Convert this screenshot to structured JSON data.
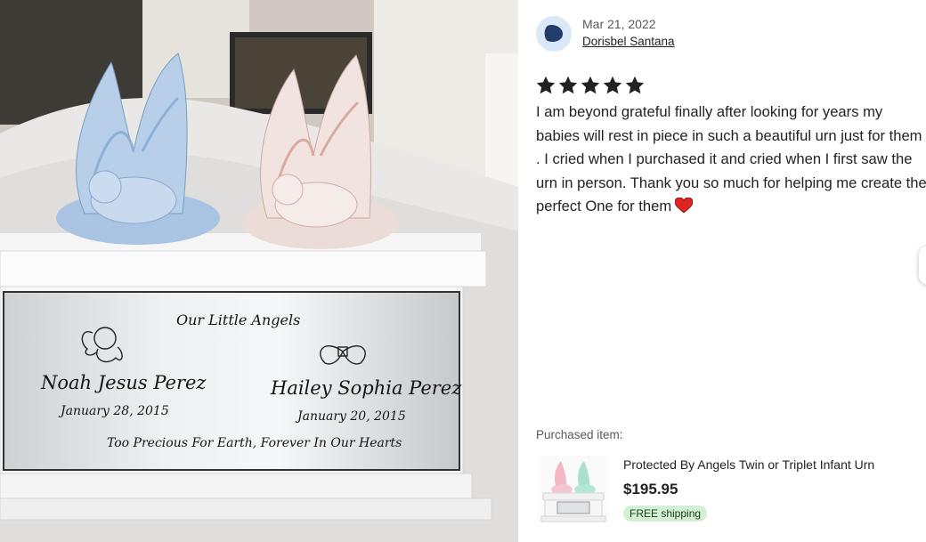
{
  "photo": {
    "plate_title": "Our Little Angels",
    "left_name": "Noah Jesus Perez",
    "left_date": "January 28, 2015",
    "right_name": "Hailey Sophia Perez",
    "right_date": "January 20, 2015",
    "quote": "Too Precious For Earth, Forever In Our Hearts"
  },
  "review": {
    "date": "Mar 21, 2022",
    "reviewer": "Dorisbel Santana",
    "rating": 5,
    "text": "I am beyond grateful finally after looking for years my babies will rest in piece in such a beautiful urn just for them . I cried when I purchased it and cried when I first saw the urn in person. Thank you so much for helping me create the perfect One for them",
    "emoji": "heart-icon"
  },
  "purchase": {
    "label": "Purchased item:",
    "title": "Protected By Angels Twin or Triplet Infant Urn",
    "price": "$195.95",
    "shipping": "FREE shipping"
  },
  "colors": {
    "star": "#222222",
    "avatar_bg": "#dbe8f7",
    "avatar_fg": "#233d6b",
    "shipping_bg": "#d4f0d4",
    "heart": "#e02424"
  }
}
